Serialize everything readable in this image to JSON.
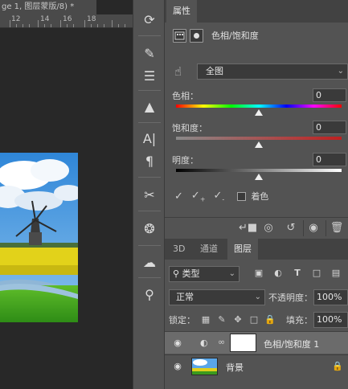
{
  "document": {
    "tab_title": "ge 1, 图层蒙版/8) *",
    "ruler_numbers": [
      "12",
      "14",
      "16",
      "18"
    ]
  },
  "tools": [
    "history-brush-icon",
    "brush-settings-icon",
    "adjustments-icon",
    "clone-source-icon",
    "character-icon",
    "paragraph-icon",
    "tool-presets-icon",
    "3d-icon",
    "libraries-icon",
    "learn-icon"
  ],
  "properties": {
    "tab_label": "属性",
    "title": "色相/饱和度",
    "preset": "全图",
    "hue_label": "色相：",
    "hue_value": "0",
    "hue_position": 0.5,
    "saturation_label": "饱和度：",
    "saturation_value": "0",
    "saturation_position": 0.5,
    "lightness_label": "明度：",
    "lightness_value": "0",
    "lightness_position": 0.5,
    "colorize_label": "着色",
    "colorize_checked": false
  },
  "layers_panel": {
    "tabs": [
      "3D",
      "通道",
      "图层"
    ],
    "active_tab": "图层",
    "filter_label": "类型",
    "blend_mode": "正常",
    "opacity_label": "不透明度：",
    "opacity_value": "100%",
    "lock_label": "锁定：",
    "fill_label": "填充：",
    "fill_value": "100%",
    "layers": [
      {
        "name": "色相/饱和度 1",
        "selected": true
      },
      {
        "name": "背景",
        "selected": false
      }
    ]
  },
  "colors": {
    "panel_bg": "#535353",
    "canvas_bg": "#282828",
    "selected_layer": "#6b6b6b"
  }
}
